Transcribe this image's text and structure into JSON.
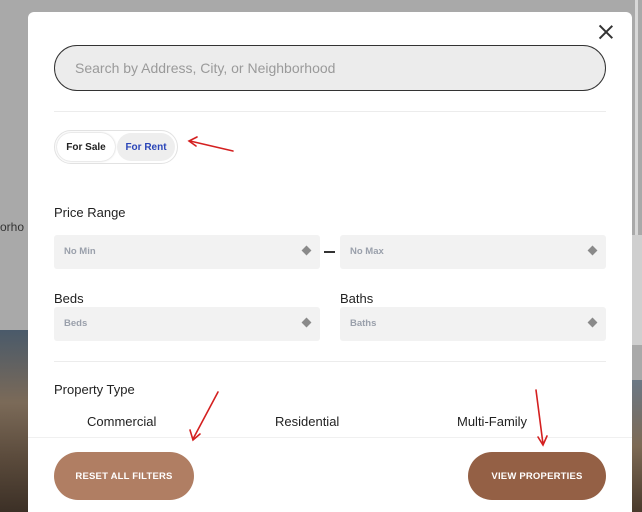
{
  "search": {
    "placeholder": "Search by Address, City, or Neighborhood"
  },
  "listing_toggle": {
    "for_sale": "For Sale",
    "for_rent": "For Rent"
  },
  "price_range": {
    "label": "Price Range",
    "min": "No Min",
    "max": "No Max"
  },
  "beds": {
    "label": "Beds",
    "value": "Beds"
  },
  "baths": {
    "label": "Baths",
    "value": "Baths"
  },
  "property_type": {
    "label": "Property Type",
    "options": [
      "Commercial",
      "Residential",
      "Multi-Family"
    ]
  },
  "buttons": {
    "reset": "RESET ALL FILTERS",
    "view": "VIEW PROPERTIES"
  },
  "background": {
    "partial_text": "orho"
  },
  "colors": {
    "accent_reset": "#b07e63",
    "accent_view": "#946045",
    "for_rent_text": "#2a45b8",
    "annotation_arrow": "#d42020"
  }
}
